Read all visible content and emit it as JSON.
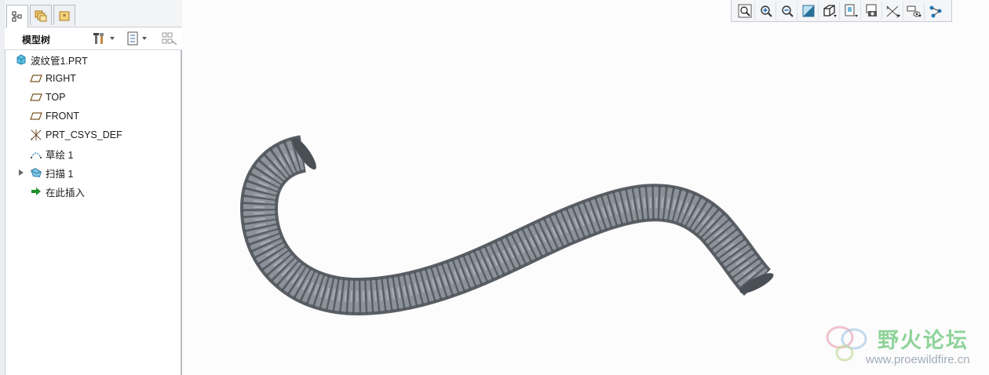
{
  "tabs": [
    {
      "icon": "model-tree-icon",
      "active": true
    },
    {
      "icon": "folder-browser-icon",
      "active": false
    },
    {
      "icon": "favorites-icon",
      "active": false
    }
  ],
  "tree_header": {
    "title": "模型树"
  },
  "tree": {
    "items": [
      {
        "label": "波纹管1.PRT",
        "icon": "part-icon"
      },
      {
        "label": "RIGHT",
        "icon": "datum-plane-icon"
      },
      {
        "label": "TOP",
        "icon": "datum-plane-icon"
      },
      {
        "label": "FRONT",
        "icon": "datum-plane-icon"
      },
      {
        "label": "PRT_CSYS_DEF",
        "icon": "csys-icon"
      },
      {
        "label": "草绘 1",
        "icon": "sketch-icon"
      },
      {
        "label": "扫描 1",
        "icon": "sweep-icon"
      },
      {
        "label": "在此插入",
        "icon": "insert-here-icon"
      }
    ]
  },
  "view_toolbar": {
    "buttons": [
      "refit-icon",
      "zoom-in-icon",
      "zoom-out-icon",
      "repaint-icon",
      "display-style-icon",
      "saved-views-icon",
      "perspective-icon",
      "datum-display-icon",
      "annotation-display-icon",
      "spin-center-icon"
    ]
  },
  "watermark": {
    "title": "野火论坛",
    "url": "www.proewildfire.cn"
  },
  "colors": {
    "tube": "#7d838a",
    "watermark_green": "#8fd39a"
  }
}
